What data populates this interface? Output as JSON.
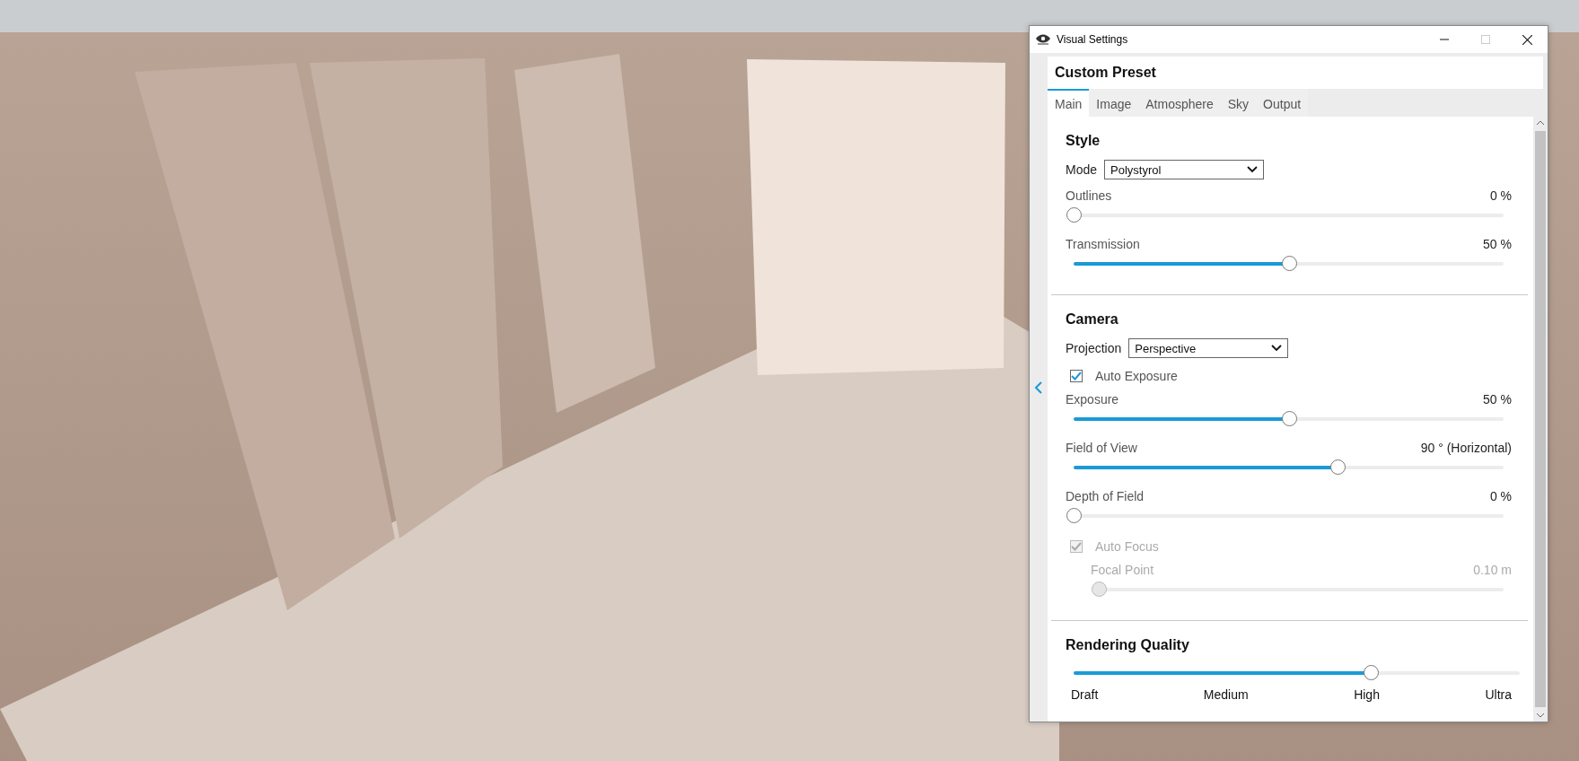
{
  "window": {
    "title": "Visual Settings"
  },
  "preset": {
    "title": "Custom Preset"
  },
  "tabs": [
    {
      "label": "Main",
      "selected": true
    },
    {
      "label": "Image",
      "selected": false
    },
    {
      "label": "Atmosphere",
      "selected": false
    },
    {
      "label": "Sky",
      "selected": false
    },
    {
      "label": "Output",
      "selected": false
    }
  ],
  "sections": [
    {
      "title": "Style",
      "items": [
        {
          "kind": "select",
          "label": "Mode",
          "value": "Polystyrol"
        },
        {
          "kind": "slider",
          "label": "Outlines",
          "reading": "0 %",
          "level": 0,
          "disabled": false
        },
        {
          "kind": "slider",
          "label": "Transmission",
          "reading": "50 %",
          "level": 0.5,
          "disabled": false
        }
      ]
    },
    {
      "title": "Camera",
      "items": [
        {
          "kind": "select",
          "label": "Projection",
          "value": "Perspective"
        },
        {
          "kind": "checkbox",
          "label": "Auto Exposure",
          "checked": true,
          "disabled": false
        },
        {
          "kind": "slider",
          "label": "Exposure",
          "reading": "50 %",
          "level": 0.5,
          "disabled": false
        },
        {
          "kind": "slider",
          "label": "Field of View",
          "reading": "90 ° (Horizontal)",
          "level": 0.614,
          "disabled": false
        },
        {
          "kind": "slider",
          "label": "Depth of Field",
          "reading": "0 %",
          "level": 0,
          "disabled": false
        },
        {
          "kind": "checkbox",
          "label": "Auto Focus",
          "checked": true,
          "disabled": true,
          "children": [
            {
              "kind": "slider",
              "label": "Focal Point",
              "reading": "0.10 m",
              "level": 0,
              "disabled": true
            }
          ]
        }
      ]
    },
    {
      "title": "Rendering Quality",
      "items": [
        {
          "kind": "scale",
          "level": 0.665,
          "ticks": [
            "Draft",
            "Medium",
            "High",
            "Ultra"
          ]
        }
      ]
    }
  ]
}
